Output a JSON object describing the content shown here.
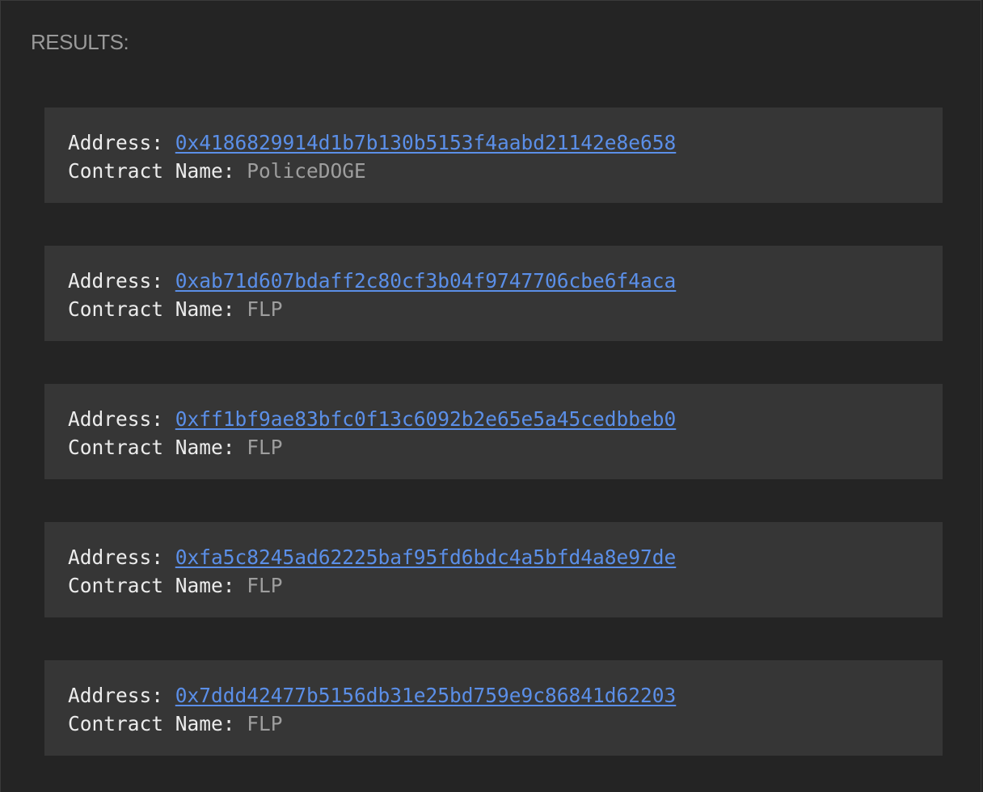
{
  "heading": "RESULTS:",
  "labels": {
    "address": "Address: ",
    "contract_name": "Contract Name: "
  },
  "results": [
    {
      "address": "0x4186829914d1b7b130b5153f4aabd21142e8e658",
      "contract_name": "PoliceDOGE"
    },
    {
      "address": "0xab71d607bdaff2c80cf3b04f9747706cbe6f4aca",
      "contract_name": "FLP"
    },
    {
      "address": "0xff1bf9ae83bfc0f13c6092b2e65e5a45cedbbeb0",
      "contract_name": "FLP"
    },
    {
      "address": "0xfa5c8245ad62225baf95fd6bdc4a5bfd4a8e97de",
      "contract_name": "FLP"
    },
    {
      "address": "0x7ddd42477b5156db31e25bd759e9c86841d62203",
      "contract_name": "FLP"
    }
  ],
  "colors": {
    "background": "#242424",
    "card": "#363636",
    "link": "#5b8fe8",
    "muted": "#9e9e9e"
  }
}
